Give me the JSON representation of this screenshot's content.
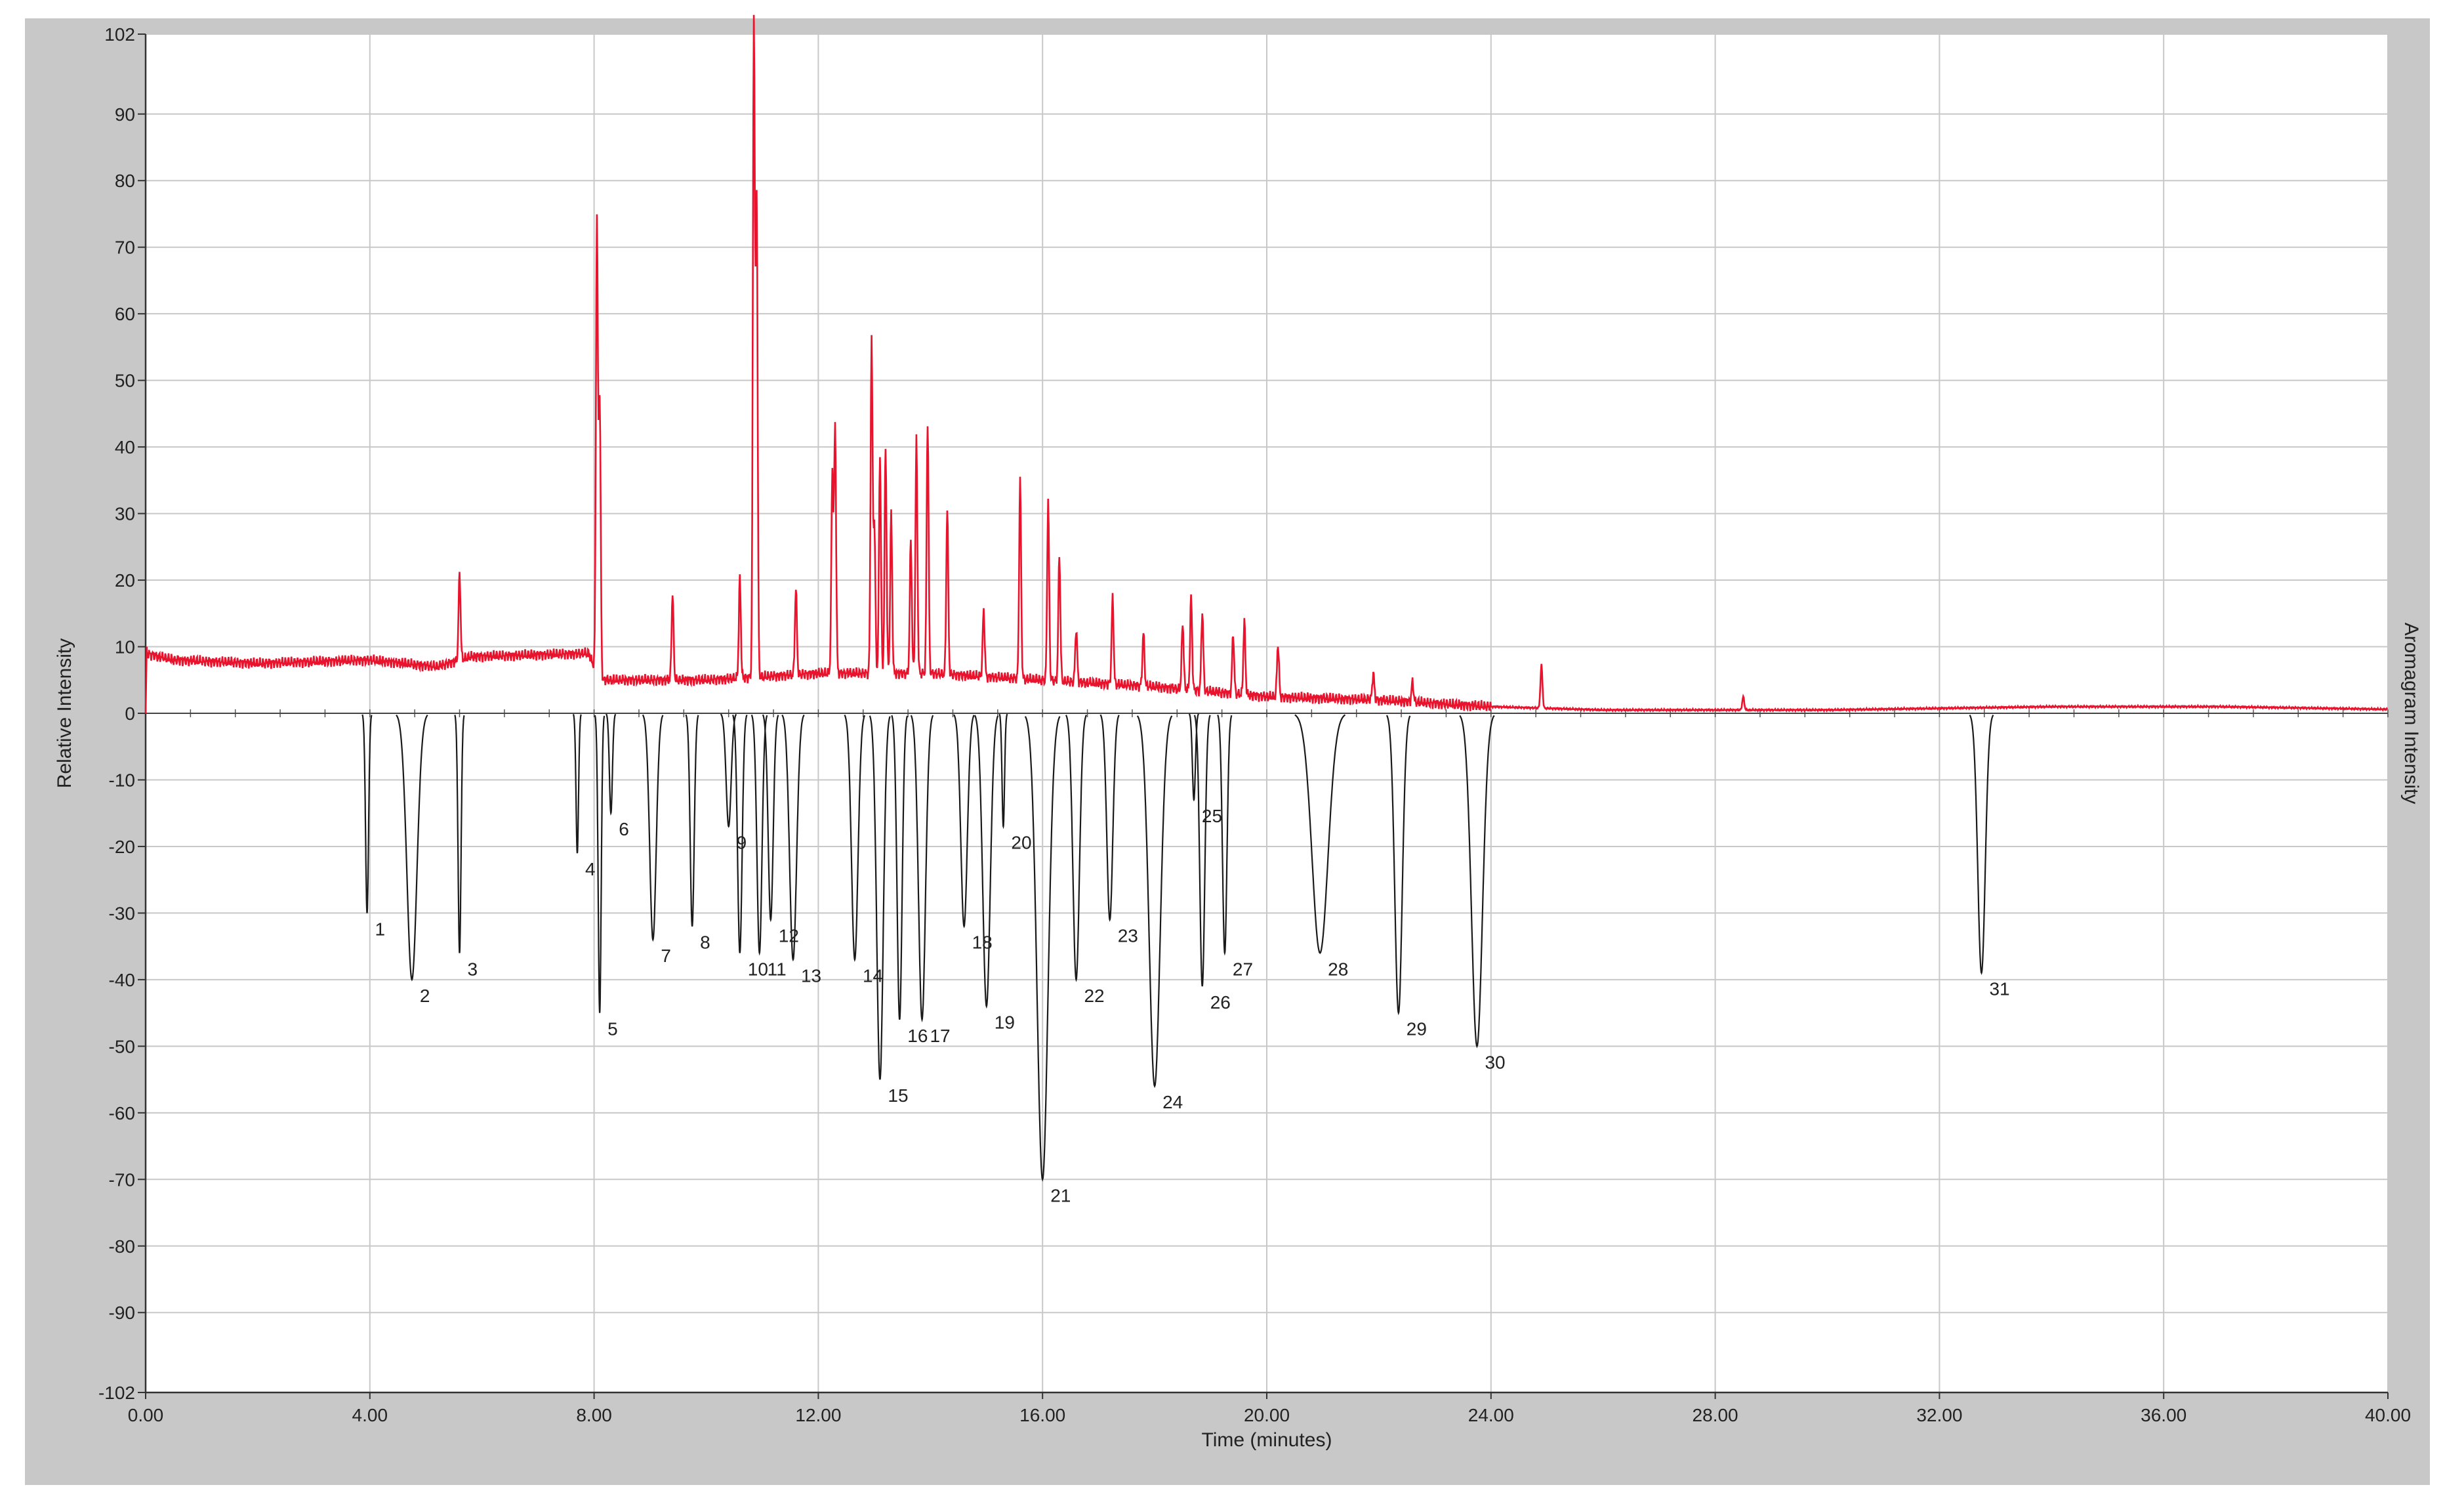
{
  "chart_data": {
    "type": "line",
    "xlabel": "Time (minutes)",
    "ylabel": "Relative Intensity",
    "y2label": "Aromagram Intensity",
    "xlim": [
      0,
      40
    ],
    "ylim": [
      -102,
      102
    ],
    "grid": true,
    "x_ticks": [
      "0.00",
      "4.00",
      "8.00",
      "12.00",
      "16.00",
      "20.00",
      "24.00",
      "28.00",
      "32.00",
      "36.00",
      "40.00"
    ],
    "y_ticks": [
      "102",
      "90",
      "80",
      "70",
      "60",
      "50",
      "40",
      "30",
      "20",
      "10",
      "0",
      "-10",
      "-20",
      "-30",
      "-40",
      "-50",
      "-60",
      "-70",
      "-80",
      "-90",
      "-102"
    ],
    "colors": {
      "chromatogram": "#e8132c",
      "aromagram": "#1a1a1a",
      "plot_bg": "#ffffff",
      "frame_bg": "#c8c8c8",
      "grid": "#c8c8c8"
    },
    "series": [
      {
        "key": "chromatogram",
        "baseline": [
          [
            0.0,
            9
          ],
          [
            0.5,
            8
          ],
          [
            2.0,
            7.5
          ],
          [
            4.0,
            8
          ],
          [
            5.2,
            7
          ],
          [
            5.8,
            8.5
          ],
          [
            7.9,
            9
          ],
          [
            8.1,
            5
          ],
          [
            10.0,
            5
          ],
          [
            12.0,
            6
          ],
          [
            14.0,
            6
          ],
          [
            16.0,
            5
          ],
          [
            18.0,
            4
          ],
          [
            20.0,
            2.5
          ],
          [
            22.0,
            2
          ],
          [
            24.0,
            1
          ],
          [
            26.0,
            0.5
          ],
          [
            30.0,
            0.5
          ],
          [
            34.0,
            1
          ],
          [
            37.0,
            1
          ],
          [
            40.0,
            0.6
          ]
        ],
        "peaks": [
          {
            "t": 5.6,
            "h": 13
          },
          {
            "t": 8.05,
            "h": 68
          },
          {
            "t": 8.1,
            "h": 42
          },
          {
            "t": 9.4,
            "h": 13
          },
          {
            "t": 10.6,
            "h": 15
          },
          {
            "t": 10.85,
            "h": 99
          },
          {
            "t": 10.9,
            "h": 72
          },
          {
            "t": 11.6,
            "h": 13
          },
          {
            "t": 12.25,
            "h": 30
          },
          {
            "t": 12.3,
            "h": 37
          },
          {
            "t": 12.95,
            "h": 50
          },
          {
            "t": 13.0,
            "h": 22
          },
          {
            "t": 13.1,
            "h": 33
          },
          {
            "t": 13.2,
            "h": 34
          },
          {
            "t": 13.3,
            "h": 24
          },
          {
            "t": 13.65,
            "h": 20
          },
          {
            "t": 13.75,
            "h": 35
          },
          {
            "t": 13.95,
            "h": 38
          },
          {
            "t": 14.3,
            "h": 25
          },
          {
            "t": 14.95,
            "h": 10
          },
          {
            "t": 15.6,
            "h": 30
          },
          {
            "t": 16.1,
            "h": 27
          },
          {
            "t": 16.3,
            "h": 19
          },
          {
            "t": 16.6,
            "h": 8
          },
          {
            "t": 17.25,
            "h": 13
          },
          {
            "t": 17.8,
            "h": 8
          },
          {
            "t": 18.5,
            "h": 10
          },
          {
            "t": 18.65,
            "h": 14
          },
          {
            "t": 18.85,
            "h": 12
          },
          {
            "t": 19.4,
            "h": 9
          },
          {
            "t": 19.6,
            "h": 11
          },
          {
            "t": 20.2,
            "h": 8
          },
          {
            "t": 21.9,
            "h": 4
          },
          {
            "t": 22.6,
            "h": 3
          },
          {
            "t": 24.9,
            "h": 6.5
          },
          {
            "t": 28.5,
            "h": 2
          }
        ]
      },
      {
        "key": "aromagram",
        "peaks": [
          {
            "id": "1",
            "t": 3.95,
            "depth": 30,
            "w": 0.06
          },
          {
            "id": "2",
            "t": 4.75,
            "depth": 40,
            "w": 0.2
          },
          {
            "id": "3",
            "t": 5.6,
            "depth": 36,
            "w": 0.06
          },
          {
            "id": "4",
            "t": 7.7,
            "depth": 21,
            "w": 0.05
          },
          {
            "id": "5",
            "t": 8.1,
            "depth": 45,
            "w": 0.06
          },
          {
            "id": "6",
            "t": 8.3,
            "depth": 15,
            "w": 0.06
          },
          {
            "id": "7",
            "t": 9.05,
            "depth": 34,
            "w": 0.13
          },
          {
            "id": "8",
            "t": 9.75,
            "depth": 32,
            "w": 0.08
          },
          {
            "id": "9",
            "t": 10.4,
            "depth": 17,
            "w": 0.1
          },
          {
            "id": "10",
            "t": 10.6,
            "depth": 36,
            "w": 0.09
          },
          {
            "id": "11",
            "t": 10.95,
            "depth": 36,
            "w": 0.1
          },
          {
            "id": "12",
            "t": 11.15,
            "depth": 31,
            "w": 0.1
          },
          {
            "id": "13",
            "t": 11.55,
            "depth": 37,
            "w": 0.14
          },
          {
            "id": "14",
            "t": 12.65,
            "depth": 37,
            "w": 0.13
          },
          {
            "id": "15",
            "t": 13.1,
            "depth": 55,
            "w": 0.13
          },
          {
            "id": "16",
            "t": 13.45,
            "depth": 46,
            "w": 0.1
          },
          {
            "id": "17",
            "t": 13.85,
            "depth": 46,
            "w": 0.14
          },
          {
            "id": "18",
            "t": 14.6,
            "depth": 32,
            "w": 0.13
          },
          {
            "id": "19",
            "t": 15.0,
            "depth": 44,
            "w": 0.15
          },
          {
            "id": "20",
            "t": 15.3,
            "depth": 17,
            "w": 0.05
          },
          {
            "id": "21",
            "t": 16.0,
            "depth": 70,
            "w": 0.22
          },
          {
            "id": "22",
            "t": 16.6,
            "depth": 40,
            "w": 0.13
          },
          {
            "id": "23",
            "t": 17.2,
            "depth": 31,
            "w": 0.12
          },
          {
            "id": "24",
            "t": 18.0,
            "depth": 56,
            "w": 0.22
          },
          {
            "id": "25",
            "t": 18.7,
            "depth": 13,
            "w": 0.06
          },
          {
            "id": "26",
            "t": 18.85,
            "depth": 41,
            "w": 0.1
          },
          {
            "id": "27",
            "t": 19.25,
            "depth": 36,
            "w": 0.09
          },
          {
            "id": "28",
            "t": 20.95,
            "depth": 36,
            "w": 0.32
          },
          {
            "id": "29",
            "t": 22.35,
            "depth": 45,
            "w": 0.15
          },
          {
            "id": "30",
            "t": 23.75,
            "depth": 50,
            "w": 0.22
          },
          {
            "id": "31",
            "t": 32.75,
            "depth": 39,
            "w": 0.15
          }
        ]
      }
    ]
  }
}
